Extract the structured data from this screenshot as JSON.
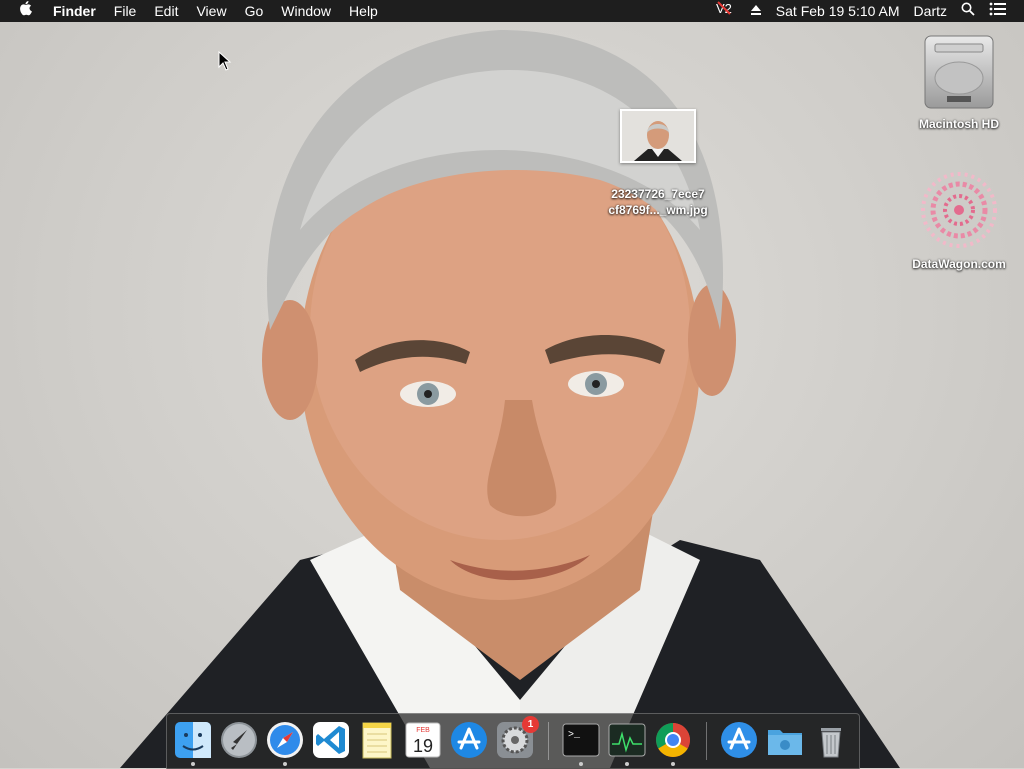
{
  "menubar": {
    "apple_glyph": "",
    "app_name": "Finder",
    "menus": [
      "File",
      "Edit",
      "View",
      "Go",
      "Window",
      "Help"
    ],
    "clock": "Sat Feb 19  5:10 AM",
    "user": "Dartz"
  },
  "desktop": {
    "file_icon": {
      "line1": "23237726_7ece7",
      "line2": "cf8769f..._wm.jpg"
    },
    "drive_icon": {
      "label": "Macintosh HD"
    },
    "web_icon": {
      "label": "DataWagon.com"
    }
  },
  "dock": {
    "apps": [
      {
        "name": "Finder",
        "icon": "finder-icon",
        "running": true
      },
      {
        "name": "Launchpad",
        "icon": "launchpad-icon",
        "running": false
      },
      {
        "name": "Safari",
        "icon": "safari-icon",
        "running": true
      },
      {
        "name": "Visual Studio Code",
        "icon": "vscode-icon",
        "running": false
      },
      {
        "name": "Notes",
        "icon": "notes-icon",
        "running": false
      },
      {
        "name": "Calendar",
        "icon": "calendar-icon",
        "running": false
      },
      {
        "name": "App Store",
        "icon": "appstore-icon",
        "running": false
      },
      {
        "name": "System Preferences",
        "icon": "system-preferences-icon",
        "running": false
      },
      {
        "name": "Terminal",
        "icon": "terminal-icon",
        "running": true
      },
      {
        "name": "Activity Monitor",
        "icon": "activity-monitor-icon",
        "running": true
      },
      {
        "name": "Google Chrome",
        "icon": "chrome-icon",
        "running": true
      },
      {
        "name": "Applications",
        "icon": "applications-folder-icon",
        "running": false
      },
      {
        "name": "Downloads",
        "icon": "downloads-folder-icon",
        "running": false
      },
      {
        "name": "Trash",
        "icon": "trash-icon",
        "running": false
      }
    ],
    "calendar": {
      "month": "FEB",
      "day": "19"
    },
    "system_prefs_badge": "1",
    "terminal_prompt": ">_"
  }
}
